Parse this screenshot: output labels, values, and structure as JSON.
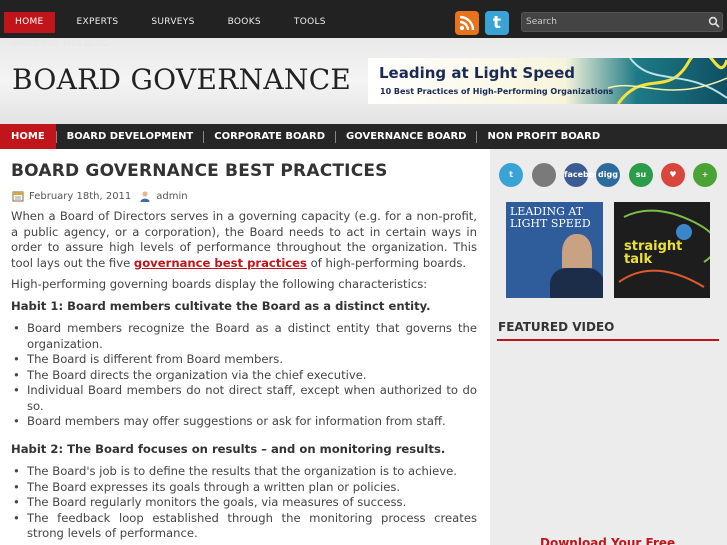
{
  "top_nav": {
    "items": [
      "HOME",
      "EXPERTS",
      "SURVEYS",
      "BOOKS",
      "TOOLS"
    ],
    "secondary_link": "WRITE FOR THIS BLOG"
  },
  "search": {
    "placeholder": "Search"
  },
  "header": {
    "site_title": "BOARD GOVERNANCE",
    "banner_title": "Leading at Light Speed",
    "banner_subtitle": "10 Best Practices of High-Performing Organizations"
  },
  "main_nav": {
    "items": [
      "HOME",
      "BOARD DEVELOPMENT",
      "CORPORATE BOARD",
      "GOVERNANCE BOARD",
      "NON PROFIT BOARD"
    ]
  },
  "post": {
    "title": "BOARD GOVERNANCE BEST PRACTICES",
    "date": "February 18th, 2011",
    "author": "admin",
    "intro_before_link": "When a Board of Directors serves in a governing capacity (e.g. for a non-profit, a public agency, or a corporation), the Board needs to act in certain ways in order to assure high levels of performance throughout the organization. This tool lays out the five",
    "intro_link": "governance best practices",
    "intro_after_link": "of high-performing boards.",
    "lead": "High-performing governing boards display the following characteristics:",
    "habits": [
      {
        "heading": "Habit 1: Board members cultivate the Board as a distinct entity.",
        "bullets": [
          "Board members recognize the Board as a distinct entity that governs the organization.",
          "The Board is different from Board members.",
          "The Board directs the organization via the chief executive.",
          "Individual Board members do not direct staff, except when authorized to do so.",
          "Board members may offer suggestions or ask for information from staff."
        ]
      },
      {
        "heading": "Habit 2: The Board focuses on results – and on monitoring results.",
        "bullets": [
          "The Board's job is to define the results that the organization is to achieve.",
          "The Board expresses its goals through a written plan or policies.",
          "The Board regularly monitors the goals, via measures of success.",
          "The feedback loop established through the monitoring process creates strong levels of performance."
        ]
      }
    ]
  },
  "sidebar": {
    "social": [
      {
        "icon": "twitter-icon",
        "label": "t",
        "color": "#3aa3d6"
      },
      {
        "icon": "delicious-icon",
        "label": "",
        "color": "#7a7a7a"
      },
      {
        "icon": "facebook-icon",
        "label": "facebook",
        "color": "#3b5b92"
      },
      {
        "icon": "digg-icon",
        "label": "digg",
        "color": "#2c6b9c"
      },
      {
        "icon": "stumbleupon-icon",
        "label": "su",
        "color": "#2b9c4a"
      },
      {
        "icon": "favorite-icon",
        "label": "♥",
        "color": "#d9463b"
      },
      {
        "icon": "add-icon",
        "label": "+",
        "color": "#4aa335"
      }
    ],
    "book1_title": "LEADING AT LIGHT SPEED",
    "book2_title": "straight talk",
    "featured_video_title": "FEATURED VIDEO",
    "download_text": "Download Your Free"
  },
  "colors": {
    "accent": "#c0151b",
    "topbar": "#222222",
    "nav": "#262626",
    "sidebar": "#ececec"
  }
}
